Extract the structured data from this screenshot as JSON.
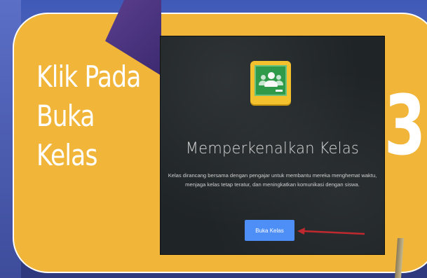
{
  "slide": {
    "instruction_lines": [
      "Klik Pada",
      "Buka",
      "Kelas"
    ],
    "step_number": "3"
  },
  "screenshot": {
    "title": "Memperkenalkan Kelas",
    "description_line1": "Kelas dirancang bersama dengan pengajar untuk membantu mereka menghemat waktu,",
    "description_line2": "menjaga kelas tetap teratur, dan meningkatkan komunikasi dengan siswa.",
    "open_button_label": "Buka Kelas"
  },
  "colors": {
    "panel": "#f1b539",
    "background": "#2f3a7e",
    "button": "#4e8ef7",
    "arrow": "#c0292f"
  },
  "icons": {
    "app_icon": "google-classroom-icon",
    "pointer": "red-arrow-icon"
  }
}
